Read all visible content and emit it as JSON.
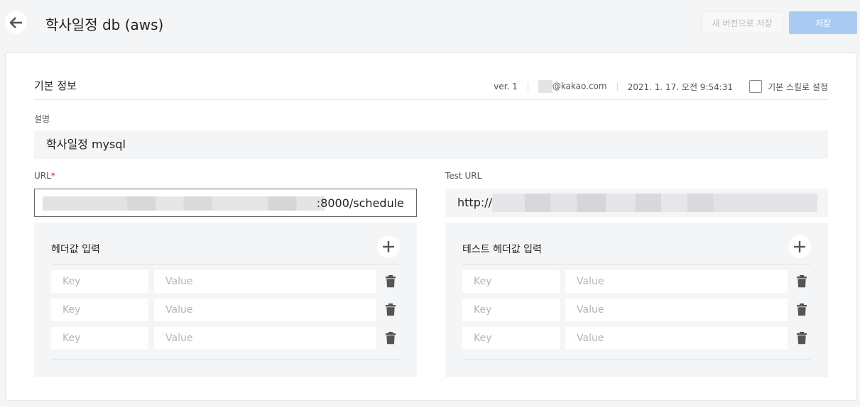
{
  "header": {
    "title": "학사일정 db (aws)",
    "save_as_new_label": "새 버전으로 저장",
    "save_label": "저장"
  },
  "basic_info": {
    "section_title": "기본 정보",
    "version": "ver. 1",
    "author_email": "@kakao.com",
    "datetime": "2021. 1. 17. 오전 9:54:31",
    "default_skill_label": "기본 스킬로 설정"
  },
  "description": {
    "label": "설명",
    "value": "학사일정 mysql"
  },
  "url": {
    "label": "URL",
    "required_mark": "*",
    "value_visible": ":8000/schedule"
  },
  "test_url": {
    "label": "Test URL",
    "value_visible": "http://"
  },
  "header_panel": {
    "title": "헤더값 입력",
    "rows": [
      {
        "key_placeholder": "Key",
        "value_placeholder": "Value"
      },
      {
        "key_placeholder": "Key",
        "value_placeholder": "Value"
      },
      {
        "key_placeholder": "Key",
        "value_placeholder": "Value"
      }
    ]
  },
  "test_header_panel": {
    "title": "테스트 헤더값 입력",
    "rows": [
      {
        "key_placeholder": "Key",
        "value_placeholder": "Value"
      },
      {
        "key_placeholder": "Key",
        "value_placeholder": "Value"
      },
      {
        "key_placeholder": "Key",
        "value_placeholder": "Value"
      }
    ]
  },
  "colors": {
    "primary_disabled": "#a9cbf1",
    "required": "#e0143c",
    "panel_bg": "#f4f5f7"
  },
  "icons": [
    "back-arrow-icon",
    "plus-icon",
    "trash-icon",
    "checkbox-icon"
  ]
}
